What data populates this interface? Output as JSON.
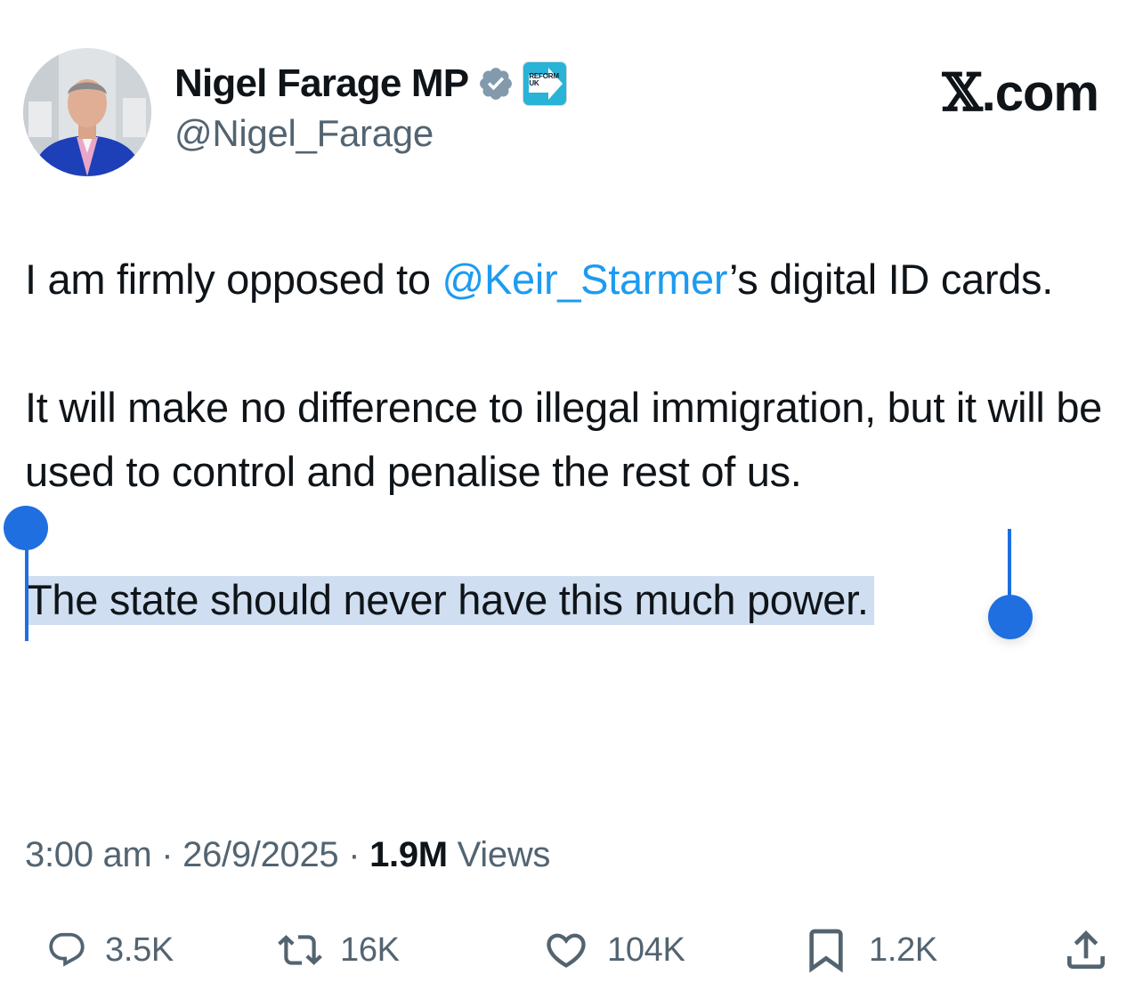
{
  "header": {
    "display_name": "Nigel Farage MP",
    "handle": "@Nigel_Farage",
    "affiliation_badge_text": "REFORM UK",
    "site_label": ".com",
    "site_mark": "𝕏"
  },
  "tweet": {
    "paragraph1_pre": "I am firmly opposed to ",
    "mention": "@Keir_Starmer",
    "paragraph1_post": "’s digital ID cards.",
    "paragraph2": "It will make no difference to illegal immigration, but it will be used to control and penalise the rest of us.",
    "paragraph3_selected": "The state should never have this much power."
  },
  "meta": {
    "time": "3:00 am",
    "separator": "·",
    "date": "26/9/2025",
    "views_count": "1.9M",
    "views_label": "Views"
  },
  "actions": {
    "replies": "3.5K",
    "reposts": "16K",
    "likes": "104K",
    "bookmarks": "1.2K"
  },
  "colors": {
    "accent": "#1d9bf0",
    "selection_highlight": "#cfdef0",
    "selection_handle": "#1f6fe0",
    "secondary_text": "#536471",
    "primary_text": "#0f1419",
    "affiliation_badge": "#29b3d6"
  },
  "icons": {
    "verified": "verified-badge-icon",
    "reply": "reply-icon",
    "repost": "repost-icon",
    "like": "heart-icon",
    "bookmark": "bookmark-icon",
    "share": "share-icon"
  }
}
